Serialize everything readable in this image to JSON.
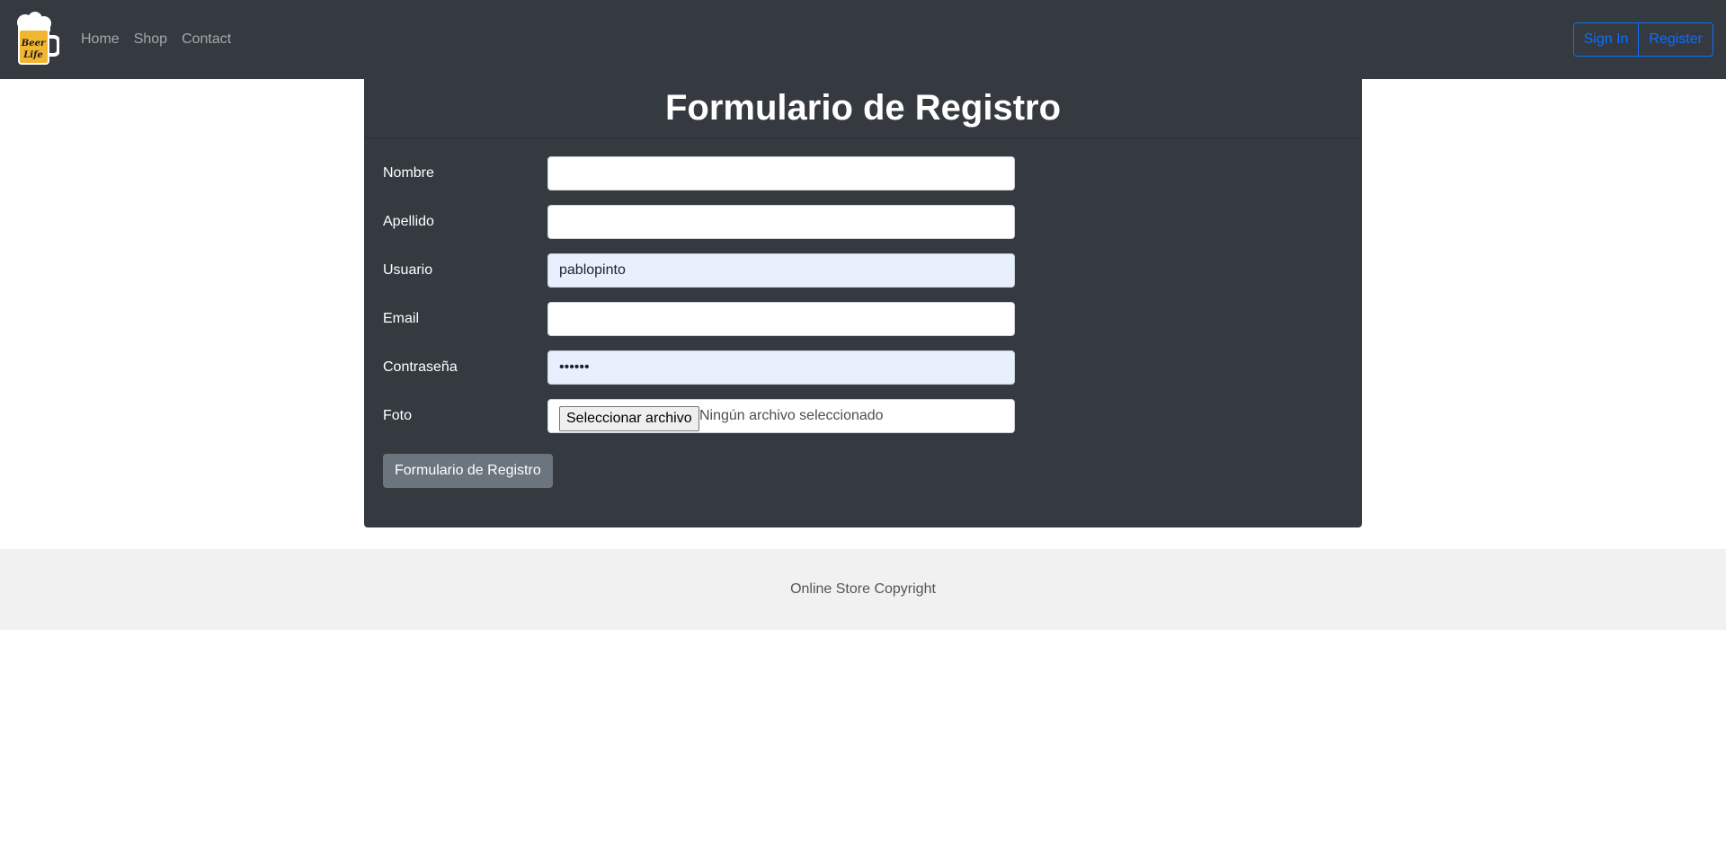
{
  "nav": {
    "logo_text": "Beer Life",
    "links": [
      "Home",
      "Shop",
      "Contact"
    ],
    "sign_in": "Sign In",
    "register": "Register",
    "accent": "#0d6efd"
  },
  "form": {
    "title": "Formulario de Registro",
    "fields": {
      "nombre": {
        "label": "Nombre",
        "value": ""
      },
      "apellido": {
        "label": "Apellido",
        "value": ""
      },
      "usuario": {
        "label": "Usuario",
        "value": "pablopinto"
      },
      "email": {
        "label": "Email",
        "value": ""
      },
      "password": {
        "label": "Contraseña",
        "value": "••••••"
      },
      "foto": {
        "label": "Foto",
        "button": "Seleccionar archivo",
        "status": "Ningún archivo seleccionado"
      }
    },
    "submit": "Formulario de Registro"
  },
  "footer": {
    "text": "Online Store Copyright"
  },
  "colors": {
    "navbar": "#343a40",
    "card": "#343a40",
    "footer": "#f1f1f1",
    "submit": "#6c757d"
  }
}
